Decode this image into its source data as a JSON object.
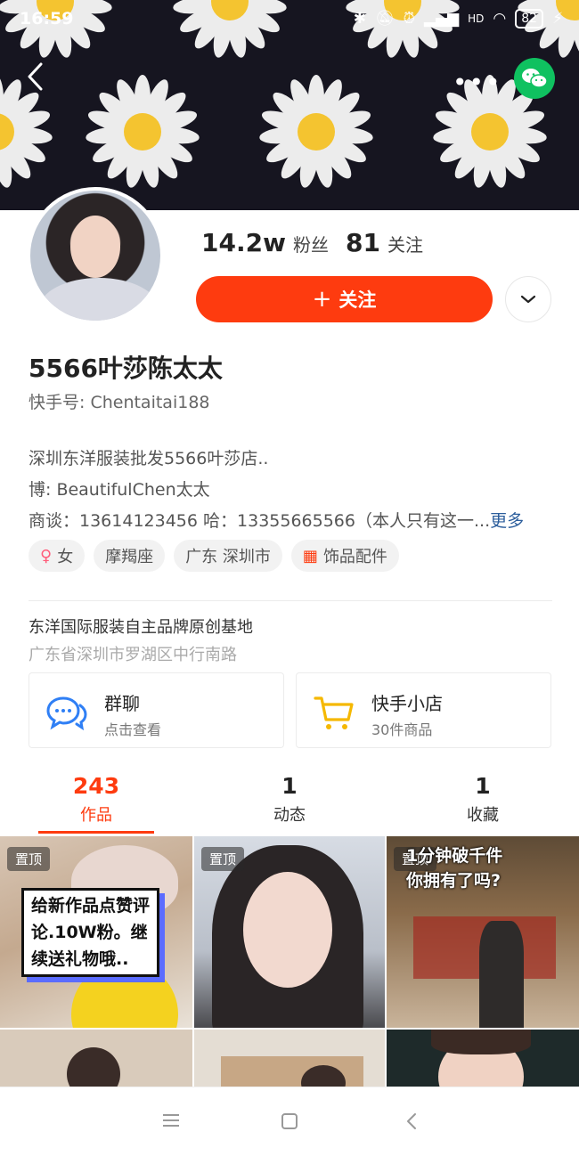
{
  "status": {
    "time": "16:59",
    "battery": "82",
    "hd": "HD"
  },
  "profile": {
    "fans_count": "14.2w",
    "fans_label": "粉丝",
    "following_count": "81",
    "following_label": "关注",
    "follow_button": "关注",
    "name": "5566叶莎陈太太",
    "kuaishou_id": "快手号: Chentaitai188",
    "bio_lines": [
      "深圳东洋服装批发5566叶莎店..",
      "博: BeautifulChen太太",
      "商谈：13614123456 哈：13355665566（本人只有这一..."
    ],
    "bio_more": "更多",
    "tags": [
      {
        "icon": "female-icon",
        "label": "女"
      },
      {
        "icon": "",
        "label": "摩羯座"
      },
      {
        "icon": "",
        "label": "广东 深圳市"
      },
      {
        "icon": "grid-icon",
        "label": "饰品配件"
      }
    ],
    "location_title": "东洋国际服装自主品牌原创基地",
    "location_address": "广东省深圳市罗湖区中行南路"
  },
  "cards": [
    {
      "icon": "group-chat-icon",
      "title": "群聊",
      "sub": "点击查看"
    },
    {
      "icon": "shop-cart-icon",
      "title": "快手小店",
      "sub": "30件商品"
    }
  ],
  "tabs": [
    {
      "count": "243",
      "label": "作品",
      "active": true
    },
    {
      "count": "1",
      "label": "动态",
      "active": false
    },
    {
      "count": "1",
      "label": "收藏",
      "active": false
    }
  ],
  "grid": {
    "pin_label": "置顶",
    "items": [
      {
        "caption": [
          "给新作品点赞评",
          "论.10W粉。继",
          "续送礼物哦.."
        ]
      },
      {
        "caption": []
      },
      {
        "caption": [
          "1分钟破千件",
          "你拥有了吗?"
        ]
      }
    ]
  },
  "colors": {
    "accent": "#fe3b0f",
    "wechat": "#0fc160",
    "link": "#2c5e9c"
  }
}
